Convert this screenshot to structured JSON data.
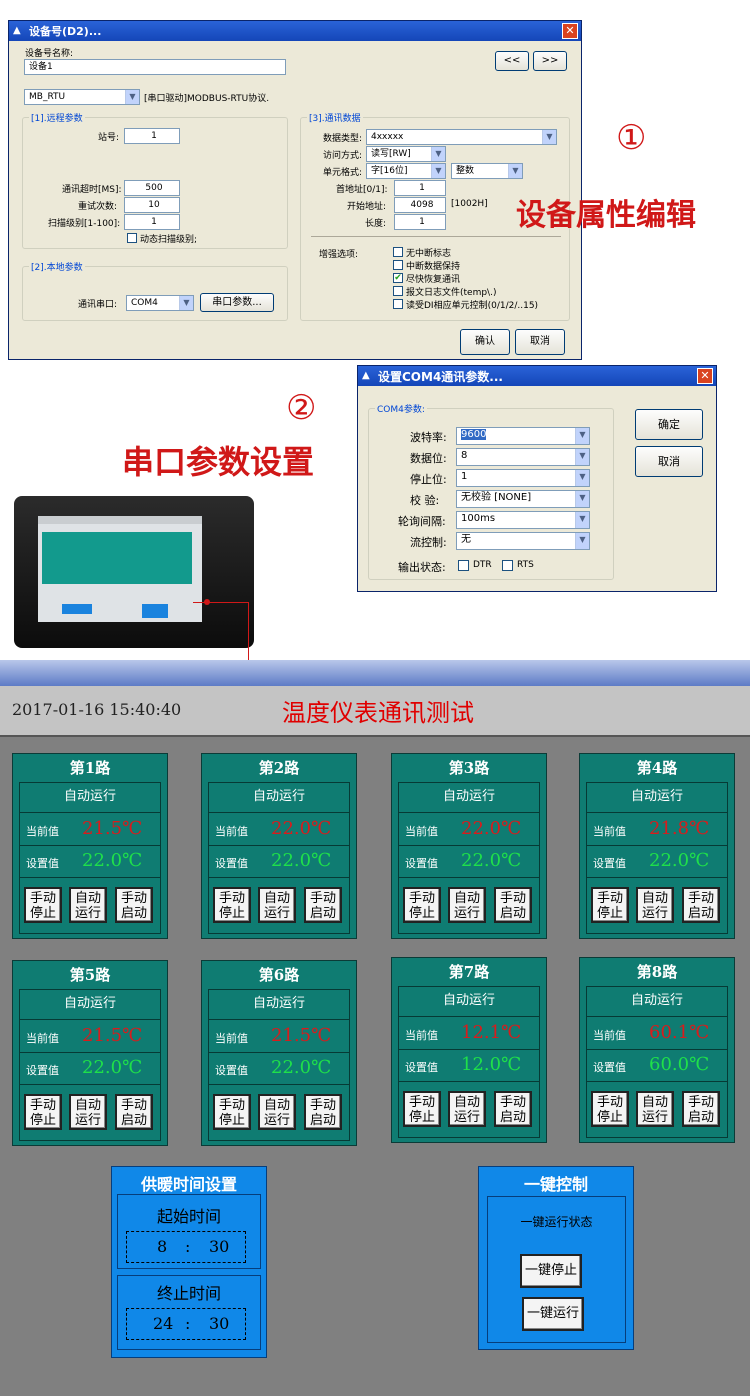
{
  "win1": {
    "title": "设备号(D2)...",
    "name_label": "设备号名称:",
    "name_value": "设备1",
    "nav_prev": "<<",
    "nav_next": ">>",
    "driver_value": "MB_RTU",
    "driver_desc": "[串口驱动]MODBUS-RTU协议.",
    "g1_title": "[1].远程参数",
    "station_label": "站号:",
    "station_value": "1",
    "timeout_label": "通讯超时[MS]:",
    "timeout_value": "500",
    "retry_label": "重试次数:",
    "retry_value": "10",
    "scan_label": "扫描级别[1-100]:",
    "scan_value": "1",
    "dyn_scan_label": "动态扫描级别;",
    "g2_title": "[2].本地参数",
    "port_label": "通讯串口:",
    "port_value": "COM4",
    "port_param_btn": "串口参数...",
    "g3_title": "[3].通讯数据",
    "dtype_label": "数据类型:",
    "dtype_value": "4xxxxx",
    "access_label": "访问方式:",
    "access_value": "读写[RW]",
    "unit_label": "单元格式:",
    "unit_value": "字[16位]",
    "unit_value2": "整数",
    "first_addr_label": "首地址[0/1]:",
    "first_addr_value": "1",
    "start_addr_label": "开始地址:",
    "start_addr_value": "4098",
    "start_addr_hex": "[1002H]",
    "length_label": "长度:",
    "length_value": "1",
    "enh_label": "增强选项:",
    "opt1": "无中断标志",
    "opt2": "中断数据保持",
    "opt3": "尽快恢复通讯",
    "opt4": "报文日志文件(temp\\.)",
    "opt5": "读受DI相应单元控制(0/1/2/..15)",
    "ok": "确认",
    "cancel": "取消"
  },
  "annot1": {
    "num": "①",
    "text": "设备属性编辑"
  },
  "annot2": {
    "num": "②",
    "text": "串口参数设置"
  },
  "win2": {
    "title": "设置COM4通讯参数...",
    "group": "COM4参数:",
    "baud_label": "波特率:",
    "baud_value": "9600",
    "data_label": "数据位:",
    "data_value": "8",
    "stop_label": "停止位:",
    "stop_value": "1",
    "parity_label": "校  验:",
    "parity_value": "无校验 [NONE]",
    "poll_label": "轮询间隔:",
    "poll_value": "100ms",
    "flow_label": "流控制:",
    "flow_value": "无",
    "out_label": "输出状态:",
    "dtr": "DTR",
    "rts": "RTS",
    "ok": "确定",
    "cancel": "取消"
  },
  "hmi": {
    "datetime": "2017-01-16 15:40:40",
    "title": "温度仪表通讯测试",
    "mode_text": "自动运行",
    "current_label": "当前值",
    "setpoint_label": "设置值",
    "btn_stop": "手动\n停止",
    "btn_auto": "自动\n运行",
    "btn_start": "手动\n启动",
    "channels": [
      {
        "name": "第1路",
        "current": "21.5℃",
        "setpoint": "22.0℃"
      },
      {
        "name": "第2路",
        "current": "22.0℃",
        "setpoint": "22.0℃"
      },
      {
        "name": "第3路",
        "current": "22.0℃",
        "setpoint": "22.0℃"
      },
      {
        "name": "第4路",
        "current": "21.8℃",
        "setpoint": "22.0℃"
      },
      {
        "name": "第5路",
        "current": "21.5℃",
        "setpoint": "22.0℃"
      },
      {
        "name": "第6路",
        "current": "21.5℃",
        "setpoint": "22.0℃"
      },
      {
        "name": "第7路",
        "current": "12.1℃",
        "setpoint": "12.0℃"
      },
      {
        "name": "第8路",
        "current": "60.1℃",
        "setpoint": "60.0℃"
      }
    ],
    "heating": {
      "title": "供暖时间设置",
      "start_label": "起始时间",
      "start_hour": "8",
      "start_min": "30",
      "end_label": "终止时间",
      "end_hour": "24",
      "end_min": "30",
      "sep": ":"
    },
    "onekey": {
      "title": "一键控制",
      "status_label": "一键运行状态",
      "stop_btn": "一键停止",
      "run_btn": "一键运行"
    }
  }
}
